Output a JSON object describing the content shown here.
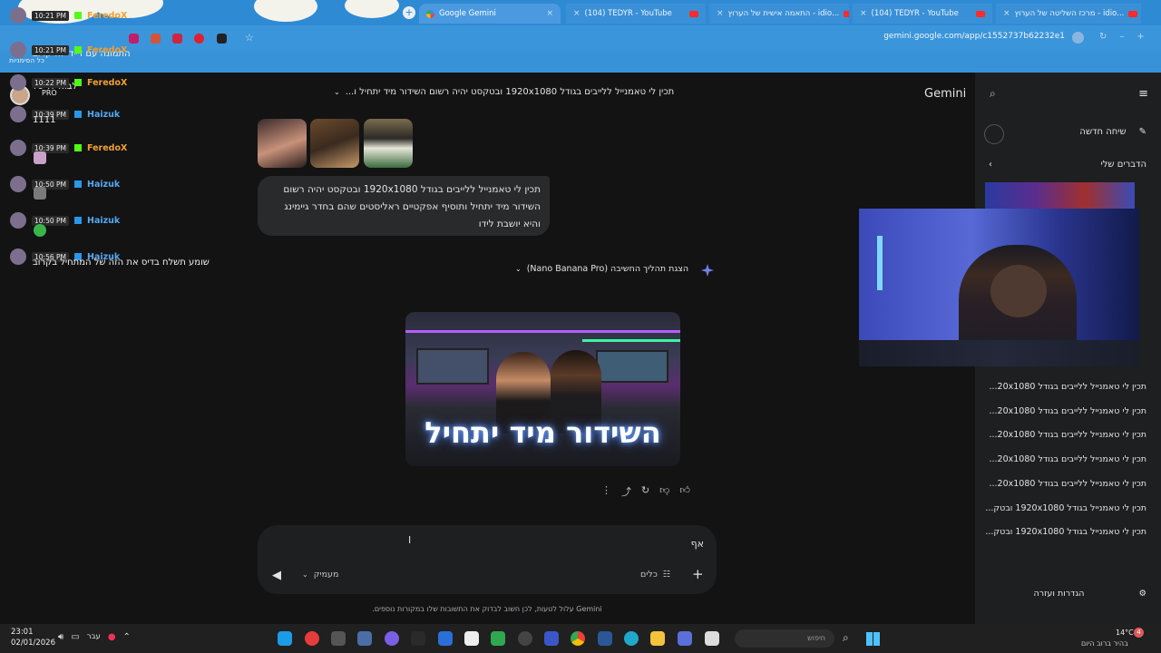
{
  "browser": {
    "tabs": [
      {
        "title": "Google Gemini",
        "active": true
      },
      {
        "title": "(104) TEDYR - YouTube"
      },
      {
        "title": "...idio - התאמה אישית של הערוץ"
      },
      {
        "title": "(104) TEDYR - YouTube"
      },
      {
        "title": "...idio - מרכז השליטה של הערוץ"
      }
    ],
    "url": "gemini.google.com/app/c1552737b62232e1"
  },
  "chat_overlay": {
    "top_lines": [
      "עם דיידי זה קרוב",
      "התמונה עם דיידי זה קרוב",
      "כל הסימניות",
      "לבוא לדיס?",
      "PRO"
    ],
    "messages": [
      {
        "time": "10:21 PM",
        "user": "FeredoX",
        "platform": "kick",
        "text": ""
      },
      {
        "time": "10:21 PM",
        "user": "FeredoX",
        "platform": "kick",
        "text": ""
      },
      {
        "time": "10:22 PM",
        "user": "FeredoX",
        "platform": "kick",
        "text": ""
      },
      {
        "time": "10:39 PM",
        "user": "Haizuk",
        "platform": "twitch",
        "text": "1111"
      },
      {
        "time": "10:39 PM",
        "user": "FeredoX",
        "platform": "kick",
        "text": ""
      },
      {
        "time": "10:50 PM",
        "user": "Haizuk",
        "platform": "twitch",
        "text": ""
      },
      {
        "time": "10:50 PM",
        "user": "Haizuk",
        "platform": "twitch",
        "text": ""
      },
      {
        "time": "10:56 PM",
        "user": "Haizuk",
        "platform": "twitch",
        "text": "שומע תשלח בדיס את הזה של המתחיל בקרוב"
      }
    ]
  },
  "gemini": {
    "brand": "Gemini",
    "conversation_title": "תכין לי טאמנייל ללייבים בגודל 1920x1080 ובטקסט יהיה רשום השידור מיד יתחיל ו...",
    "user_message": "תכין לי טאמנייל ללייבים בגודל 1920x1080 ובטקסט יהיה רשום השידור מיד יתחיל ותוסיף אפקטיים ראליסטים שהם בחדר גיימינג והיא יושבת לידו",
    "thinking_label": "הצגת תהליך החשיבה (Nano Banana Pro)",
    "generated_image_text": "השידור מיד יתחיל",
    "prompt_value": "אף",
    "tools_label": "כלים",
    "mode_label": "מעמיק",
    "disclaimer": "Gemini עלול לטעות, לכן חשוב לבדוק את התשובות שלו במקורות נוספים.",
    "sidebar": {
      "new_chat": "שיחה חדשה",
      "my_stuff": "הדברים שלי",
      "recent": [
        "תכין לי טאמנייל ללייבים בגודל 20x1080...",
        "תכין לי טאמנייל ללייבים בגודל 20x1080...",
        "תכין לי טאמנייל ללייבים בגודל 20x1080...",
        "תכין לי טאמנייל ללייבים בגודל 20x1080...",
        "תכין לי טאמנייל ללייבים בגודל 20x1080...",
        "תכין לי טאמנייל בגודל 1920x1080 ובטק...",
        "תכין לי טאמנייל בגודל 1920x1080 ובטק..."
      ],
      "settings": "הגדרות ועזרה"
    }
  },
  "taskbar": {
    "time": "23:01",
    "date": "02/01/2026",
    "language": "עבר",
    "weather_temp": "14°C",
    "weather_desc": "בהיר ברוב היום",
    "search_placeholder": "חיפוש",
    "notification_count": "4"
  }
}
